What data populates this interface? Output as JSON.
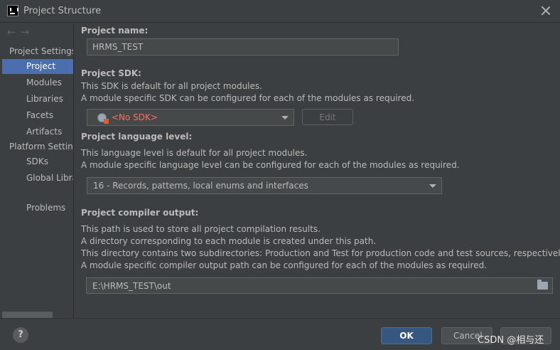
{
  "window": {
    "title": "Project Structure"
  },
  "sidebar": {
    "back_arrow": "←",
    "forward_arrow": "→",
    "project_settings_header": "Project Settings",
    "items_project": [
      "Project",
      "Modules",
      "Libraries",
      "Facets",
      "Artifacts"
    ],
    "platform_settings_header": "Platform Settings",
    "items_platform": [
      "SDKs",
      "Global Libraries"
    ],
    "problems": "Problems",
    "selected": "Project"
  },
  "main": {
    "project_name_label": "Project name:",
    "project_name_value": "HRMS_TEST",
    "project_sdk_label": "Project SDK:",
    "project_sdk_desc1": "This SDK is default for all project modules.",
    "project_sdk_desc2": "A module specific SDK can be configured for each of the modules as required.",
    "sdk_value": "<No SDK>",
    "edit_button": "Edit",
    "language_level_label": "Project language level:",
    "language_level_desc1": "This language level is default for all project modules.",
    "language_level_desc2": "A module specific language level can be configured for each of the modules as required.",
    "language_level_value": "16 - Records, patterns, local enums and interfaces",
    "compiler_output_label": "Project compiler output:",
    "compiler_desc1": "This path is used to store all project compilation results.",
    "compiler_desc2": "A directory corresponding to each module is created under this path.",
    "compiler_desc3": "This directory contains two subdirectories: Production and Test for production code and test sources, respectively.",
    "compiler_desc4": "A module specific compiler output path can be configured for each of the modules as required.",
    "compiler_output_value": "E:\\HRMS_TEST\\out"
  },
  "footer": {
    "help": "?",
    "ok": "OK",
    "cancel": "Cancel",
    "watermark": "CSDN @相与还"
  },
  "colors": {
    "background": "#3c3f41",
    "selection": "#4b6eaf",
    "ok_button": "#365880",
    "error_text": "#ff6b68"
  }
}
